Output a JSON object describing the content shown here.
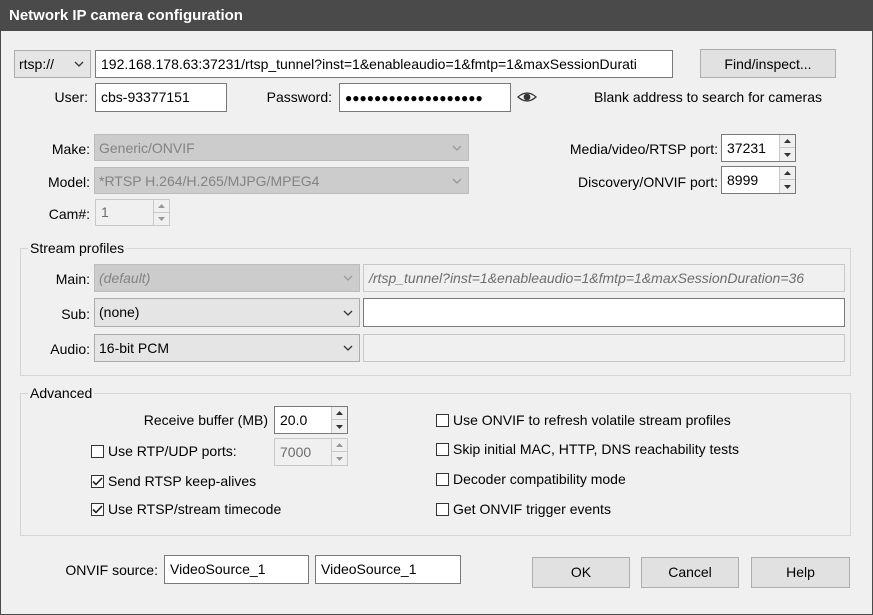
{
  "window": {
    "title": "Network IP camera configuration"
  },
  "address": {
    "protocol": "rtsp://",
    "url": "192.168.178.63:37231/rtsp_tunnel?inst=1&enableaudio=1&fmtp=1&maxSessionDurati",
    "find_button": "Find/inspect...",
    "hint": "Blank address to search for cameras"
  },
  "credentials": {
    "user_label": "User:",
    "user_value": "cbs-93377151",
    "password_label": "Password:",
    "password_value": "●●●●●●●●●●●●●●●●●●●"
  },
  "device": {
    "make_label": "Make:",
    "make_value": "Generic/ONVIF",
    "model_label": "Model:",
    "model_value": "*RTSP H.264/H.265/MJPG/MPEG4",
    "cam_label": "Cam#:",
    "cam_value": "1"
  },
  "ports": {
    "media_label": "Media/video/RTSP port:",
    "media_value": "37231",
    "discovery_label": "Discovery/ONVIF port:",
    "discovery_value": "8999"
  },
  "stream_profiles": {
    "title": "Stream profiles",
    "main_label": "Main:",
    "main_value": "(default)",
    "main_path": "/rtsp_tunnel?inst=1&enableaudio=1&fmtp=1&maxSessionDuration=36",
    "sub_label": "Sub:",
    "sub_value": "(none)",
    "sub_path": "",
    "audio_label": "Audio:",
    "audio_value": "16-bit PCM",
    "audio_path": ""
  },
  "advanced": {
    "title": "Advanced",
    "receive_buffer_label": "Receive buffer (MB)",
    "receive_buffer_value": "20.0",
    "rtp_udp_label": "Use RTP/UDP ports:",
    "rtp_udp_checked": false,
    "rtp_udp_value": "7000",
    "keepalive_label": "Send RTSP keep-alives",
    "keepalive_checked": true,
    "timecode_label": "Use RTSP/stream timecode",
    "timecode_checked": true,
    "onvif_refresh_label": "Use ONVIF to refresh volatile stream profiles",
    "onvif_refresh_checked": false,
    "skip_tests_label": "Skip initial MAC, HTTP, DNS reachability tests",
    "skip_tests_checked": false,
    "decoder_compat_label": "Decoder compatibility mode",
    "decoder_compat_checked": false,
    "onvif_trigger_label": "Get ONVIF trigger events",
    "onvif_trigger_checked": false
  },
  "onvif_source": {
    "label": "ONVIF source:",
    "value1": "VideoSource_1",
    "value2": "VideoSource_1"
  },
  "buttons": {
    "ok": "OK",
    "cancel": "Cancel",
    "help": "Help"
  }
}
